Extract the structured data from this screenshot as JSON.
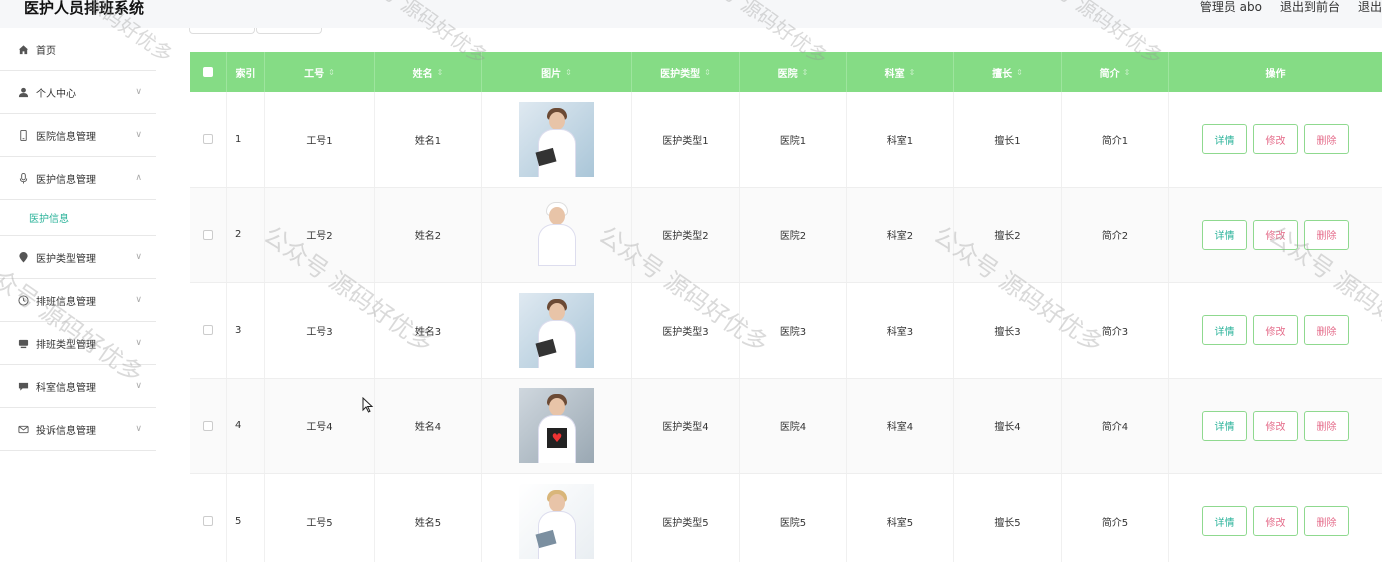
{
  "app": {
    "title": "医护人员排班系统"
  },
  "topbar": {
    "user": "管理员 abo",
    "to_front": "退出到前台",
    "logout": "退出"
  },
  "sidebar": {
    "items": [
      {
        "label": "首页",
        "icon": "home-icon",
        "chevron": false
      },
      {
        "label": "个人中心",
        "icon": "user-icon",
        "chevron": true
      },
      {
        "label": "医院信息管理",
        "icon": "phone-icon",
        "chevron": true
      },
      {
        "label": "医护信息管理",
        "icon": "microphone-icon",
        "chevron": true,
        "expanded": true
      },
      {
        "label": "医护类型管理",
        "icon": "location-icon",
        "chevron": true
      },
      {
        "label": "排班信息管理",
        "icon": "clock-icon",
        "chevron": true
      },
      {
        "label": "排班类型管理",
        "icon": "monitor-icon",
        "chevron": true
      },
      {
        "label": "科室信息管理",
        "icon": "chat-icon",
        "chevron": true
      },
      {
        "label": "投诉信息管理",
        "icon": "mail-icon",
        "chevron": true
      }
    ],
    "sub_item": "医护信息"
  },
  "table": {
    "headers": [
      "索引",
      "工号",
      "姓名",
      "图片",
      "医护类型",
      "医院",
      "科室",
      "擅长",
      "简介",
      "操作"
    ],
    "rows": [
      {
        "index": "1",
        "job_no": "工号1",
        "name": "姓名1",
        "photo": "doctor-clipboard",
        "type": "医护类型1",
        "hospital": "医院1",
        "dept": "科室1",
        "skill": "擅长1",
        "intro": "简介1"
      },
      {
        "index": "2",
        "job_no": "工号2",
        "name": "姓名2",
        "photo": "nurse-white",
        "type": "医护类型2",
        "hospital": "医院2",
        "dept": "科室2",
        "skill": "擅长2",
        "intro": "简介2"
      },
      {
        "index": "3",
        "job_no": "工号3",
        "name": "姓名3",
        "photo": "doctor-clipboard",
        "type": "医护类型3",
        "hospital": "医院3",
        "dept": "科室3",
        "skill": "擅长3",
        "intro": "简介3"
      },
      {
        "index": "4",
        "job_no": "工号4",
        "name": "姓名4",
        "photo": "doctor-heart",
        "type": "医护类型4",
        "hospital": "医院4",
        "dept": "科室4",
        "skill": "擅长4",
        "intro": "简介4"
      },
      {
        "index": "5",
        "job_no": "工号5",
        "name": "姓名5",
        "photo": "doctor-tablet",
        "type": "医护类型5",
        "hospital": "医院5",
        "dept": "科室5",
        "skill": "擅长5",
        "intro": "简介5"
      }
    ],
    "actions": {
      "detail": "详情",
      "edit": "修改",
      "delete": "删除"
    }
  },
  "watermark": "公众号 源码好优多",
  "colors": {
    "header_green": "#85dc85",
    "accent_teal": "#2bb39a",
    "danger_pink": "#e56d8b"
  }
}
